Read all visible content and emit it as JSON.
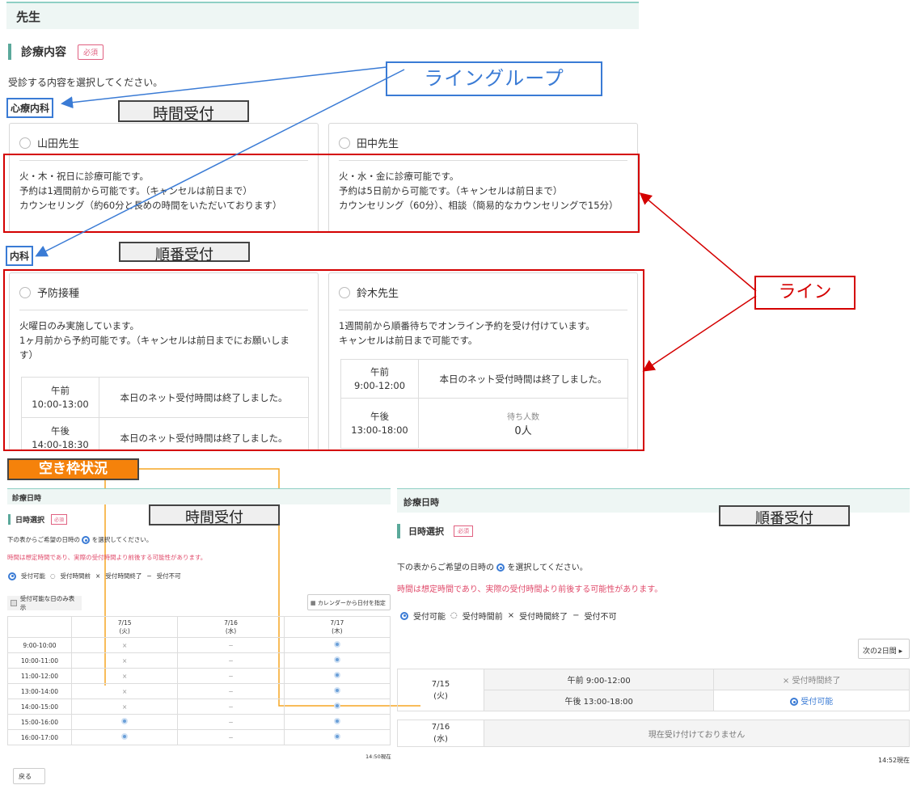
{
  "header": {
    "title": "先生"
  },
  "section": {
    "title": "診療内容",
    "badge": "必須",
    "instruction": "受診する内容を選択してください。"
  },
  "groups": [
    {
      "name": "心療内科",
      "reception_type": "時間受付"
    },
    {
      "name": "内科",
      "reception_type": "順番受付"
    }
  ],
  "cards": [
    {
      "name": "山田先生",
      "desc": [
        "火・木・祝日に診療可能です。",
        "予約は1週間前から可能です。（キャンセルは前日まで）",
        "カウンセリング（約60分と長めの時間をいただいております）"
      ]
    },
    {
      "name": "田中先生",
      "desc": [
        "火・水・金に診療可能です。",
        "予約は5日前から可能です。（キャンセルは前日まで）",
        "カウンセリング（60分）、相談（簡易的なカウンセリングで15分）"
      ]
    },
    {
      "name": "予防接種",
      "desc": [
        "火曜日のみ実施しています。",
        "1ヶ月前から予約可能です。（キャンセルは前日までにお願いしま",
        "す）"
      ],
      "hours": [
        {
          "period": "午前",
          "time": "10:00-13:00",
          "status": "本日のネット受付時間は終了しました。"
        },
        {
          "period": "午後",
          "time": "14:00-18:30",
          "status": "本日のネット受付時間は終了しました。"
        }
      ]
    },
    {
      "name": "鈴木先生",
      "desc": [
        "1週間前から順番待ちでオンライン予約を受け付けています。",
        "キャンセルは前日まで可能です。"
      ],
      "hours": [
        {
          "period": "午前",
          "time": "9:00-12:00",
          "status": "本日のネット受付時間は終了しました。"
        },
        {
          "period": "午後",
          "time": "13:00-18:00",
          "wait_label": "待ち人数",
          "wait_count": "0人"
        }
      ]
    }
  ],
  "annotations": {
    "line_group": "ライングループ",
    "line": "ライン",
    "availability": "空き枠状況",
    "time_reception": "時間受付",
    "order_reception": "順番受付"
  },
  "left_panel": {
    "header": "診療日時",
    "section_title": "日時選択",
    "badge": "必須",
    "instruction_pre": "下の表からご希望の日時の",
    "instruction_post": "を選択してください。",
    "note": "時間は想定時間であり、実際の受付時間より前後する可能性があります。",
    "legend": [
      "受付可能",
      "受付時間前",
      "受付時間終了",
      "受付不可"
    ],
    "checkbox_label": "受付可能な日のみ表示",
    "calendar_button": "カレンダーから日付を指定",
    "dates": [
      {
        "date": "7/15",
        "dow": "(火)"
      },
      {
        "date": "7/16",
        "dow": "(水)"
      },
      {
        "date": "7/17",
        "dow": "(木)"
      }
    ],
    "rows": [
      {
        "time": "9:00-10:00",
        "cells": [
          "×",
          "−",
          "◎"
        ]
      },
      {
        "time": "10:00-11:00",
        "cells": [
          "×",
          "−",
          "◎"
        ]
      },
      {
        "time": "11:00-12:00",
        "cells": [
          "×",
          "−",
          "◎"
        ]
      },
      {
        "time": "13:00-14:00",
        "cells": [
          "×",
          "−",
          "◎"
        ]
      },
      {
        "time": "14:00-15:00",
        "cells": [
          "×",
          "−",
          "◎"
        ]
      },
      {
        "time": "15:00-16:00",
        "cells": [
          "◎",
          "−",
          "◎"
        ]
      },
      {
        "time": "16:00-17:00",
        "cells": [
          "◎",
          "−",
          "◎"
        ]
      }
    ],
    "timestamp": "14:50現在",
    "back_button": "戻る"
  },
  "right_panel": {
    "header": "診療日時",
    "section_title": "日時選択",
    "badge": "必須",
    "instruction_pre": "下の表からご希望の日時の",
    "instruction_post": "を選択してください。",
    "note": "時間は想定時間であり、実際の受付時間より前後する可能性があります。",
    "legend": [
      "受付可能",
      "受付時間前",
      "受付時間終了",
      "受付不可"
    ],
    "next_button": "次の2日間",
    "day1": {
      "date": "7/15",
      "dow": "(火)",
      "slots": [
        {
          "time": "午前 9:00-12:00",
          "status": "受付時間終了"
        },
        {
          "time": "午後 13:00-18:00",
          "status": "受付可能"
        }
      ]
    },
    "day2": {
      "date": "7/16",
      "dow": "(水)",
      "status": "現在受け付けておりません"
    },
    "timestamp": "14:52現在"
  },
  "colors": {
    "accent": "#5ba99b",
    "required": "#e06080",
    "red": "#d40000",
    "blue": "#3a7bd5",
    "orange": "#f5820b"
  }
}
